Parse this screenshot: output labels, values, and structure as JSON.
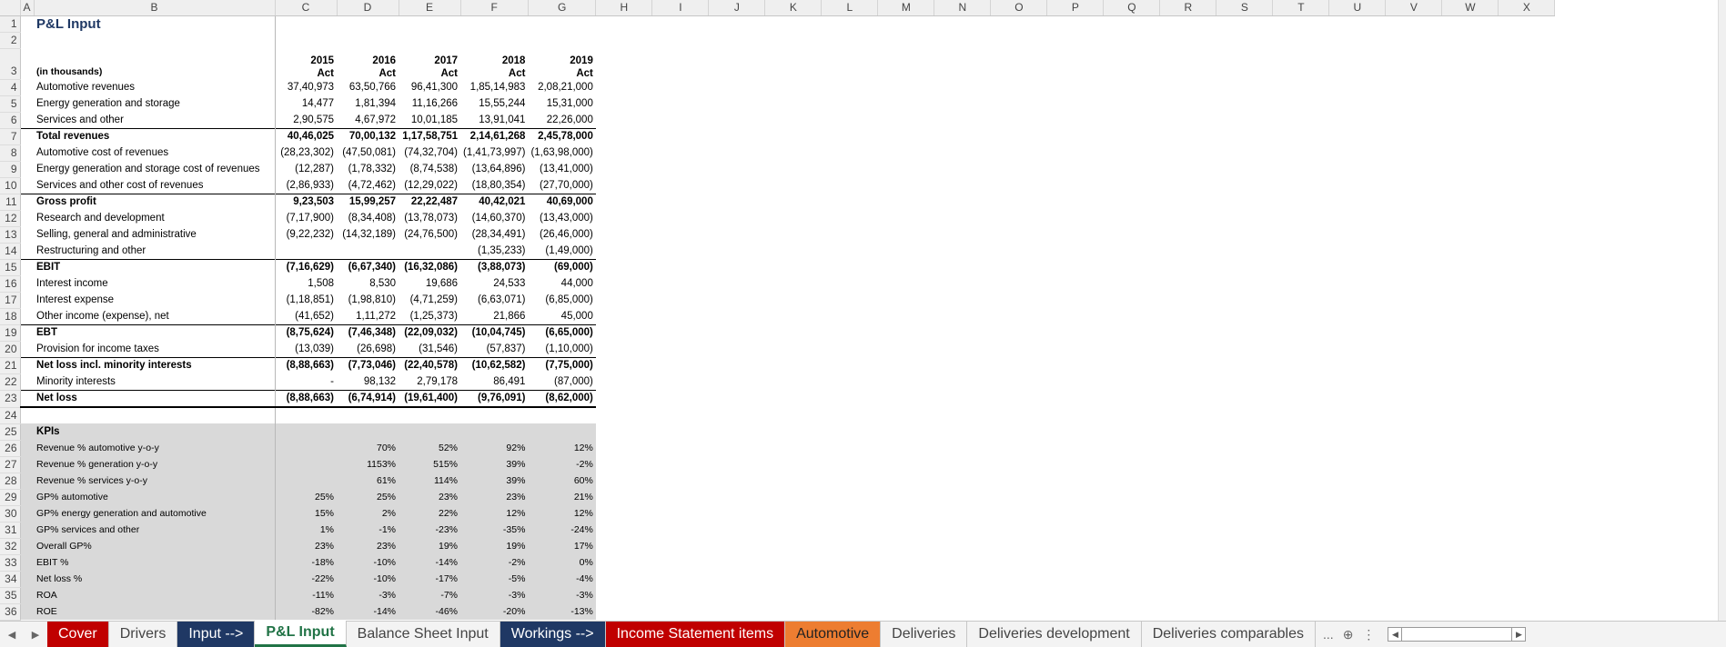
{
  "columns": [
    "A",
    "B",
    "C",
    "D",
    "E",
    "F",
    "G",
    "H",
    "I",
    "J",
    "K",
    "L",
    "M",
    "N",
    "O",
    "P",
    "Q",
    "R",
    "S",
    "T",
    "U",
    "V",
    "W",
    "X"
  ],
  "sheet_title": "P&L Input",
  "years": [
    "2015",
    "2016",
    "2017",
    "2018",
    "2019"
  ],
  "act_label": "Act",
  "units_label": "(in thousands)",
  "pnl_rows": [
    {
      "row": "4",
      "label": "Automotive revenues",
      "vals": [
        "37,40,973",
        "63,50,766",
        "96,41,300",
        "1,85,14,983",
        "2,08,21,000"
      ]
    },
    {
      "row": "5",
      "label": "Energy generation and storage",
      "vals": [
        "14,477",
        "1,81,394",
        "11,16,266",
        "15,55,244",
        "15,31,000"
      ]
    },
    {
      "row": "6",
      "label": "Services and other",
      "vals": [
        "2,90,575",
        "4,67,972",
        "10,01,185",
        "13,91,041",
        "22,26,000"
      ]
    },
    {
      "row": "7",
      "label": "Total revenues",
      "vals": [
        "40,46,025",
        "70,00,132",
        "1,17,58,751",
        "2,14,61,268",
        "2,45,78,000"
      ],
      "bold": true,
      "topline": true
    },
    {
      "row": "8",
      "label": "Automotive cost of revenues",
      "vals": [
        "(28,23,302)",
        "(47,50,081)",
        "(74,32,704)",
        "(1,41,73,997)",
        "(1,63,98,000)"
      ]
    },
    {
      "row": "9",
      "label": "Energy generation and storage cost of revenues",
      "vals": [
        "(12,287)",
        "(1,78,332)",
        "(8,74,538)",
        "(13,64,896)",
        "(13,41,000)"
      ]
    },
    {
      "row": "10",
      "label": "Services and other cost of revenues",
      "vals": [
        "(2,86,933)",
        "(4,72,462)",
        "(12,29,022)",
        "(18,80,354)",
        "(27,70,000)"
      ]
    },
    {
      "row": "11",
      "label": "Gross profit",
      "vals": [
        "9,23,503",
        "15,99,257",
        "22,22,487",
        "40,42,021",
        "40,69,000"
      ],
      "bold": true,
      "topline": true
    },
    {
      "row": "12",
      "label": "Research and development",
      "vals": [
        "(7,17,900)",
        "(8,34,408)",
        "(13,78,073)",
        "(14,60,370)",
        "(13,43,000)"
      ]
    },
    {
      "row": "13",
      "label": "Selling, general and administrative",
      "vals": [
        "(9,22,232)",
        "(14,32,189)",
        "(24,76,500)",
        "(28,34,491)",
        "(26,46,000)"
      ]
    },
    {
      "row": "14",
      "label": "Restructuring and other",
      "vals": [
        "",
        "",
        "",
        "(1,35,233)",
        "(1,49,000)"
      ]
    },
    {
      "row": "15",
      "label": "EBIT",
      "vals": [
        "(7,16,629)",
        "(6,67,340)",
        "(16,32,086)",
        "(3,88,073)",
        "(69,000)"
      ],
      "bold": true,
      "topline": true
    },
    {
      "row": "16",
      "label": "Interest income",
      "vals": [
        "1,508",
        "8,530",
        "19,686",
        "24,533",
        "44,000"
      ]
    },
    {
      "row": "17",
      "label": "Interest expense",
      "vals": [
        "(1,18,851)",
        "(1,98,810)",
        "(4,71,259)",
        "(6,63,071)",
        "(6,85,000)"
      ]
    },
    {
      "row": "18",
      "label": "Other income (expense), net",
      "vals": [
        "(41,652)",
        "1,11,272",
        "(1,25,373)",
        "21,866",
        "45,000"
      ]
    },
    {
      "row": "19",
      "label": "EBT",
      "vals": [
        "(8,75,624)",
        "(7,46,348)",
        "(22,09,032)",
        "(10,04,745)",
        "(6,65,000)"
      ],
      "bold": true,
      "topline": true
    },
    {
      "row": "20",
      "label": "Provision for income taxes",
      "vals": [
        "(13,039)",
        "(26,698)",
        "(31,546)",
        "(57,837)",
        "(1,10,000)"
      ]
    },
    {
      "row": "21",
      "label": "Net loss incl. minority interests",
      "vals": [
        "(8,88,663)",
        "(7,73,046)",
        "(22,40,578)",
        "(10,62,582)",
        "(7,75,000)"
      ],
      "bold": true,
      "topline": true
    },
    {
      "row": "22",
      "label": "Minority interests",
      "vals": [
        "-",
        "98,132",
        "2,79,178",
        "86,491",
        "(87,000)"
      ]
    },
    {
      "row": "23",
      "label": "Net loss",
      "vals": [
        "(8,88,663)",
        "(6,74,914)",
        "(19,61,400)",
        "(9,76,091)",
        "(8,62,000)"
      ],
      "bold": true,
      "topline": true,
      "dbl": true
    }
  ],
  "kpi_title": "KPIs",
  "kpi_rows": [
    {
      "row": "26",
      "label": "Revenue % automotive y-o-y",
      "vals": [
        "",
        "70%",
        "52%",
        "92%",
        "12%"
      ]
    },
    {
      "row": "27",
      "label": "Revenue % generation y-o-y",
      "vals": [
        "",
        "1153%",
        "515%",
        "39%",
        "-2%"
      ]
    },
    {
      "row": "28",
      "label": "Revenue % services y-o-y",
      "vals": [
        "",
        "61%",
        "114%",
        "39%",
        "60%"
      ]
    },
    {
      "row": "29",
      "label": "GP% automotive",
      "vals": [
        "25%",
        "25%",
        "23%",
        "23%",
        "21%"
      ]
    },
    {
      "row": "30",
      "label": "GP% energy generation and automotive",
      "vals": [
        "15%",
        "2%",
        "22%",
        "12%",
        "12%"
      ]
    },
    {
      "row": "31",
      "label": "GP% services and other",
      "vals": [
        "1%",
        "-1%",
        "-23%",
        "-35%",
        "-24%"
      ]
    },
    {
      "row": "32",
      "label": "Overall GP%",
      "vals": [
        "23%",
        "23%",
        "19%",
        "19%",
        "17%"
      ]
    },
    {
      "row": "33",
      "label": "EBIT %",
      "vals": [
        "-18%",
        "-10%",
        "-14%",
        "-2%",
        "0%"
      ]
    },
    {
      "row": "34",
      "label": "Net loss %",
      "vals": [
        "-22%",
        "-10%",
        "-17%",
        "-5%",
        "-4%"
      ]
    },
    {
      "row": "35",
      "label": "ROA",
      "vals": [
        "-11%",
        "-3%",
        "-7%",
        "-3%",
        "-3%"
      ]
    },
    {
      "row": "36",
      "label": "ROE",
      "vals": [
        "-82%",
        "-14%",
        "-46%",
        "-20%",
        "-13%"
      ]
    }
  ],
  "tabs": [
    {
      "label": "Cover",
      "color": "#c00000",
      "text": "#ffffff"
    },
    {
      "label": "Drivers",
      "color": "#f3f3f3",
      "text": "#444444"
    },
    {
      "label": "Input -->",
      "color": "#1f3864",
      "text": "#ffffff"
    },
    {
      "label": "P&L Input",
      "color": "#ffffff",
      "text": "#217346",
      "active": true
    },
    {
      "label": "Balance Sheet Input",
      "color": "#f3f3f3",
      "text": "#444444"
    },
    {
      "label": "Workings -->",
      "color": "#1f3864",
      "text": "#ffffff"
    },
    {
      "label": "Income Statement items",
      "color": "#c00000",
      "text": "#ffffff"
    },
    {
      "label": "Automotive",
      "color": "#ed7d31",
      "text": "#222222"
    },
    {
      "label": "Deliveries",
      "color": "#f3f3f3",
      "text": "#444444"
    },
    {
      "label": "Deliveries development",
      "color": "#f3f3f3",
      "text": "#444444"
    },
    {
      "label": "Deliveries comparables",
      "color": "#f3f3f3",
      "text": "#444444"
    }
  ],
  "tab_overflow": "...",
  "tab_add": "⊕",
  "tab_options": "⋮"
}
